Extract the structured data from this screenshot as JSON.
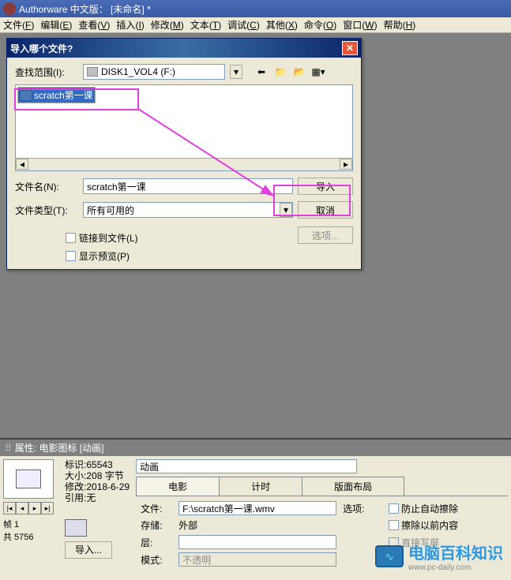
{
  "titlebar": {
    "app_name": "Authorware 中文版：",
    "doc_name": "[未命名]",
    "modified": "*"
  },
  "menus": [
    {
      "label": "文件",
      "key": "F"
    },
    {
      "label": "编辑",
      "key": "E"
    },
    {
      "label": "查看",
      "key": "V"
    },
    {
      "label": "插入",
      "key": "I"
    },
    {
      "label": "修改",
      "key": "M"
    },
    {
      "label": "文本",
      "key": "T"
    },
    {
      "label": "调试",
      "key": "C"
    },
    {
      "label": "其他",
      "key": "X"
    },
    {
      "label": "命令",
      "key": "O"
    },
    {
      "label": "窗口",
      "key": "W"
    },
    {
      "label": "帮助",
      "key": "H"
    }
  ],
  "dialog": {
    "title": "导入哪个文件?",
    "lookin_label": "查找范围(I):",
    "lookin_value": "DISK1_VOL4 (F:)",
    "selected_file": "scratch第一课",
    "filename_label": "文件名(N):",
    "filename_value": "scratch第一课",
    "filetype_label": "文件类型(T):",
    "filetype_value": "所有可用的",
    "import_btn": "导入",
    "cancel_btn": "取消",
    "options_btn": "选项...",
    "link_checkbox": "链接到文件(L)",
    "preview_checkbox": "显示预览(P)"
  },
  "panel": {
    "title": "属性: 电影图标 [动画]",
    "id_label": "标识:",
    "id_value": "65543",
    "size_label": "大小:",
    "size_value": "208 字节",
    "modified_label": "修改:",
    "modified_value": "2018-6-29",
    "ref_label": "引用:",
    "ref_value": "无",
    "frame_label": "帧 1",
    "total_label": "共 5756",
    "import_btn": "导入...",
    "title_value": "动画",
    "tabs": [
      "电影",
      "计时",
      "版面布局"
    ],
    "file_label": "文件:",
    "file_value": "F:\\scratch第一课.wmv",
    "storage_label": "存储:",
    "storage_value": "外部",
    "layer_label": "层:",
    "mode_label": "模式:",
    "mode_value": "不透明",
    "options_label": "选项:",
    "opt1": "防止自动擦除",
    "opt2": "擦除以前内容",
    "opt3": "直接写屏"
  },
  "watermark": {
    "brand": "电脑百科知识",
    "url": "www.pc-daily.com"
  }
}
